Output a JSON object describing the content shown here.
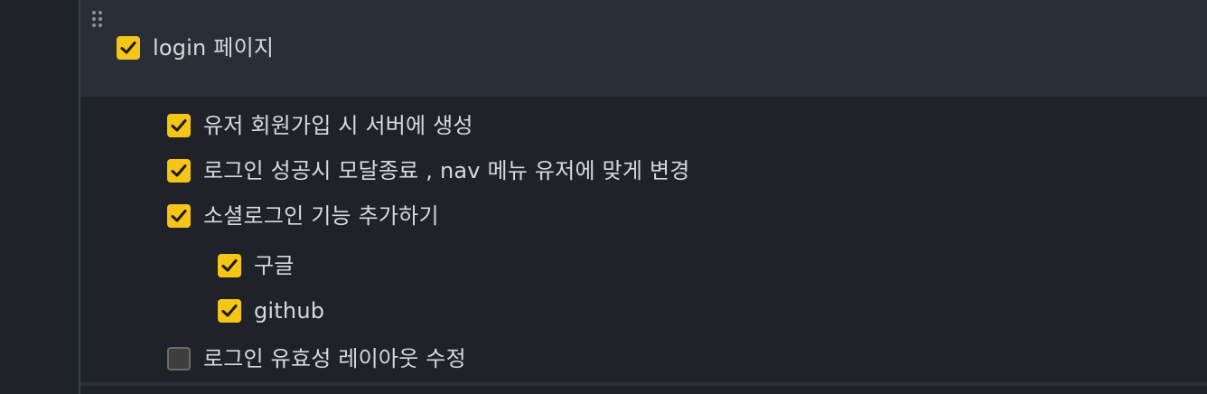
{
  "colors": {
    "checkbox_checked": "#f5c518",
    "checkbox_unchecked": "#3e3e3e",
    "background": "#1f2329",
    "block_highlight": "#2a2e36",
    "text": "#d6d9de"
  },
  "icons": {
    "drag_handle": "drag-handle-icon",
    "checkmark": "check-icon"
  },
  "tasks": [
    {
      "label": "login 페이지",
      "checked": true,
      "level": 0
    },
    {
      "label": "유저 회원가입 시 서버에 생성",
      "checked": true,
      "level": 1
    },
    {
      "label": "로그인 성공시 모달종료 , nav 메뉴 유저에 맞게 변경",
      "checked": true,
      "level": 1
    },
    {
      "label": "소셜로그인 기능 추가하기",
      "checked": true,
      "level": 1
    },
    {
      "label": "구글",
      "checked": true,
      "level": 2
    },
    {
      "label": "github",
      "checked": true,
      "level": 2
    },
    {
      "label": "로그인 유효성 레이아웃 수정",
      "checked": false,
      "level": 1
    }
  ]
}
